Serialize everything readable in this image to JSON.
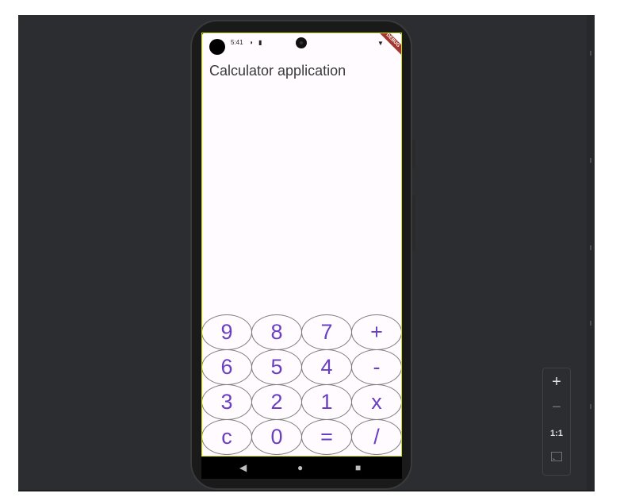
{
  "status_bar": {
    "time": "5:41",
    "left_icons": [
      "status-circle-icon",
      "sim-card-icon"
    ],
    "right_icons": [
      "wifi-icon"
    ],
    "debug_banner": "DEBUG"
  },
  "app": {
    "title": "Calculator application"
  },
  "keypad": {
    "accent_color": "#6a3fc2",
    "rows": [
      [
        "9",
        "8",
        "7",
        "+"
      ],
      [
        "6",
        "5",
        "4",
        "-"
      ],
      [
        "3",
        "2",
        "1",
        "x"
      ],
      [
        "c",
        "0",
        "=",
        "/"
      ]
    ]
  },
  "nav_bar": {
    "buttons": [
      "back-icon",
      "home-icon",
      "recents-icon"
    ]
  },
  "emulator_zoom": {
    "zoom_in": "+",
    "zoom_out": "−",
    "actual_size": "1:1",
    "fit_icon": "fit-screen-icon"
  }
}
